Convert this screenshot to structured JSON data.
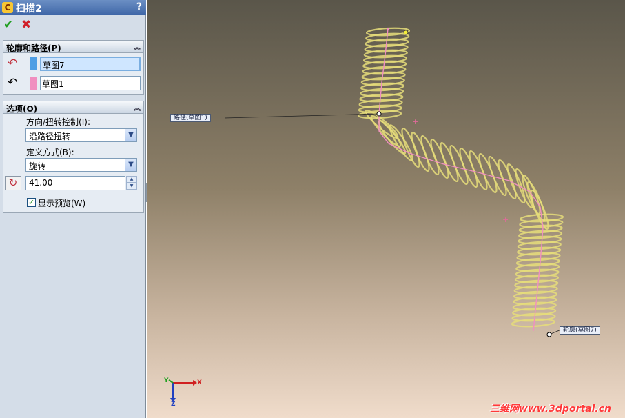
{
  "panel": {
    "title": "扫描2",
    "help": "?",
    "ok_glyph": "✔",
    "cancel_glyph": "✖",
    "profile_group": {
      "header": "轮廓和路径(P)",
      "profile_value": "草图7",
      "path_value": "草图1",
      "profile_color": "#4f9ee4",
      "path_color": "#f08fc0"
    },
    "options_group": {
      "header": "选项(O)",
      "orientation_label": "方向/扭转控制(I):",
      "orientation_value": "沿路径扭转",
      "define_label": "定义方式(B):",
      "define_value": "旋转",
      "twist_value": "41.00",
      "preview_label": "显示预览(W)",
      "preview_checked": true
    }
  },
  "viewport": {
    "path_callout": "路径(草图1)",
    "profile_callout": "轮廓(草图7)",
    "axis_x": "X",
    "axis_y": "Y",
    "axis_z": "Z",
    "watermark": "三维网www.3dportal.cn",
    "spring_color": "#e6dd7a",
    "path_line_color": "#f08fc0"
  }
}
